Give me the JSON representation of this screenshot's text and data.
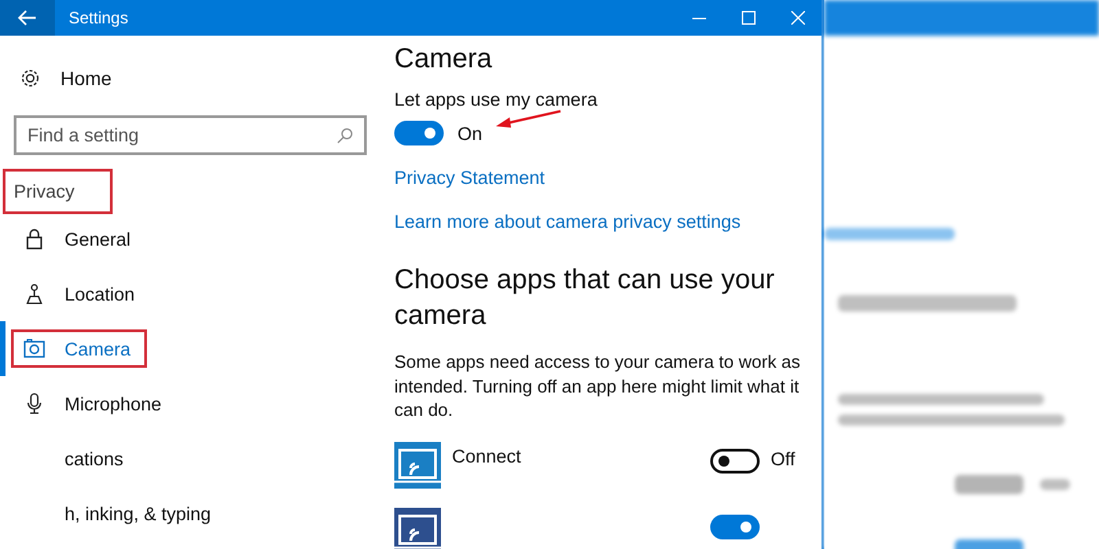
{
  "window": {
    "title": "Settings"
  },
  "sidebar": {
    "home": "Home",
    "search": {
      "placeholder": "Find a setting"
    },
    "section": {
      "label": "Privacy",
      "highlighted": true
    },
    "items": [
      {
        "label": "General",
        "kind": "lock",
        "selected": false,
        "highlighted": false
      },
      {
        "label": "Location",
        "kind": "location",
        "selected": false,
        "highlighted": false
      },
      {
        "label": "Camera",
        "kind": "camera",
        "selected": true,
        "highlighted": true
      },
      {
        "label": "Microphone",
        "kind": "microphone",
        "selected": false,
        "highlighted": false
      },
      {
        "label": "cations",
        "kind": "text",
        "selected": false,
        "highlighted": false
      },
      {
        "label": "h, inking, & typing",
        "kind": "text",
        "selected": false,
        "highlighted": false
      }
    ]
  },
  "main": {
    "title": "Camera",
    "master_toggle": {
      "label": "Let apps use my camera",
      "on": true,
      "status": "On",
      "arrow": true
    },
    "links": [
      "Privacy Statement",
      "Learn more about camera privacy settings"
    ],
    "apps_heading": "Choose apps that can use your camera",
    "apps_description": "Some apps need access to your camera to work as intended. Turning off an app here might limit what it can do.",
    "apps": [
      {
        "name": "Connect",
        "on": false,
        "status": "Off",
        "color": "#1a7fc4"
      },
      {
        "on": true,
        "color": "#2d4f8e"
      }
    ]
  }
}
